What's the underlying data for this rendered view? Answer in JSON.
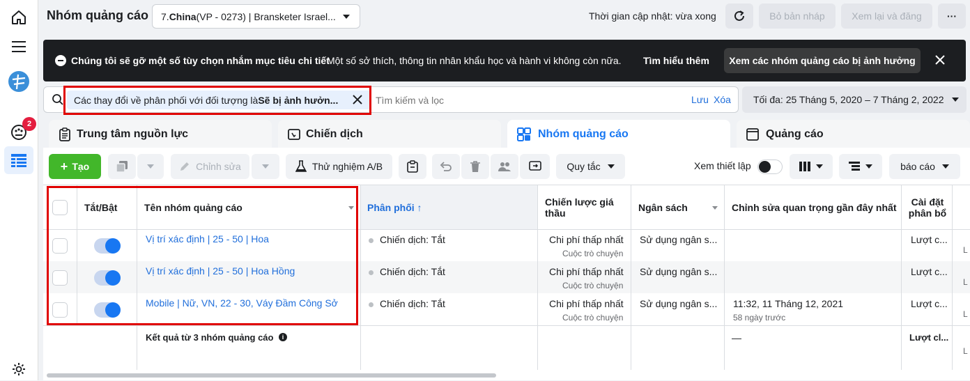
{
  "header": {
    "title": "Nhóm quảng cáo",
    "account_prefix": "7. ",
    "account_bold": "China",
    "account_rest": " (VP - 0273) | Bransketer Israel...",
    "update_status": "Thời gian cập nhật: vừa xong",
    "discard_label": "Bỏ bản nháp",
    "review_label": "Xem lại và đăng",
    "more_label": "···"
  },
  "banner": {
    "title": "Chúng tôi sẽ gỡ một số tùy chọn nhắm mục tiêu chi tiết",
    "text": "Một số sở thích, thông tin nhân khẩu học và hành vi không còn nữa.",
    "learn_more": "Tìm hiểu thêm",
    "action": "Xem các nhóm quảng cáo bị ảnh hưởng"
  },
  "search": {
    "filter_prefix": "Các thay đổi về phân phối với đối tượng là ",
    "filter_bold": "Sẽ bị ảnh hưởn...",
    "placeholder": "Tìm kiếm và lọc",
    "save": "Lưu",
    "clear": "Xóa",
    "date_range": "Tối đa: 25 Tháng 5, 2020 – 7 Tháng 2, 2022"
  },
  "tabs": [
    {
      "label": "Trung tâm nguồn lực"
    },
    {
      "label": "Chiến dịch"
    },
    {
      "label": "Nhóm quảng cáo"
    },
    {
      "label": "Quảng cáo"
    }
  ],
  "toolbar": {
    "create": "Tạo",
    "edit": "Chỉnh sửa",
    "ab_test": "Thử nghiệm A/B",
    "rules": "Quy tắc",
    "view_setup": "Xem thiết lập",
    "report": "báo cáo"
  },
  "table": {
    "headers": {
      "toggle": "Tắt/Bật",
      "name": "Tên nhóm quảng cáo",
      "delivery": "Phân phối ↑",
      "bid": "Chiến lược giá thầu",
      "budget": "Ngân sách",
      "last_edit": "Chỉnh sửa quan trọng gần đây nhất",
      "attribution": "Cài đặt phân bổ"
    },
    "rows": [
      {
        "name": "Vị trí xác định | 25 - 50 | Hoa",
        "delivery": "Chiến dịch: Tắt",
        "bid": "Chi phí thấp nhất",
        "bid_sub": "Cuộc trò chuyện",
        "budget": "Sử dụng ngân s...",
        "edit": "",
        "edit_sub": "",
        "attribution": "Lượt c...",
        "extra": "L"
      },
      {
        "name": "Vị trí xác định | 25 - 50 | Hoa Hồng",
        "delivery": "Chiến dịch: Tắt",
        "bid": "Chi phí thấp nhất",
        "bid_sub": "Cuộc trò chuyện",
        "budget": "Sử dụng ngân s...",
        "edit": "",
        "edit_sub": "",
        "attribution": "Lượt c...",
        "extra": "L"
      },
      {
        "name": "Mobile | Nữ, VN, 22 - 30, Váy Đầm Công Sở",
        "delivery": "Chiến dịch: Tắt",
        "bid": "Chi phí thấp nhất",
        "bid_sub": "Cuộc trò chuyện",
        "budget": "Sử dụng ngân s...",
        "edit": "11:32, 11 Tháng 12, 2021",
        "edit_sub": "58 ngày trước",
        "attribution": "Lượt c...",
        "extra": "L"
      }
    ],
    "summary": {
      "label": "Kết quả từ 3 nhóm quảng cáo",
      "edit": "—",
      "attribution": "Lượt cl...",
      "extra": "L"
    }
  },
  "nav": {
    "notification_count": "2"
  },
  "colors": {
    "accent": "#1877f2",
    "create_green": "#42b72a",
    "highlight_red": "#e00000",
    "banner_bg": "#1c1e21"
  }
}
